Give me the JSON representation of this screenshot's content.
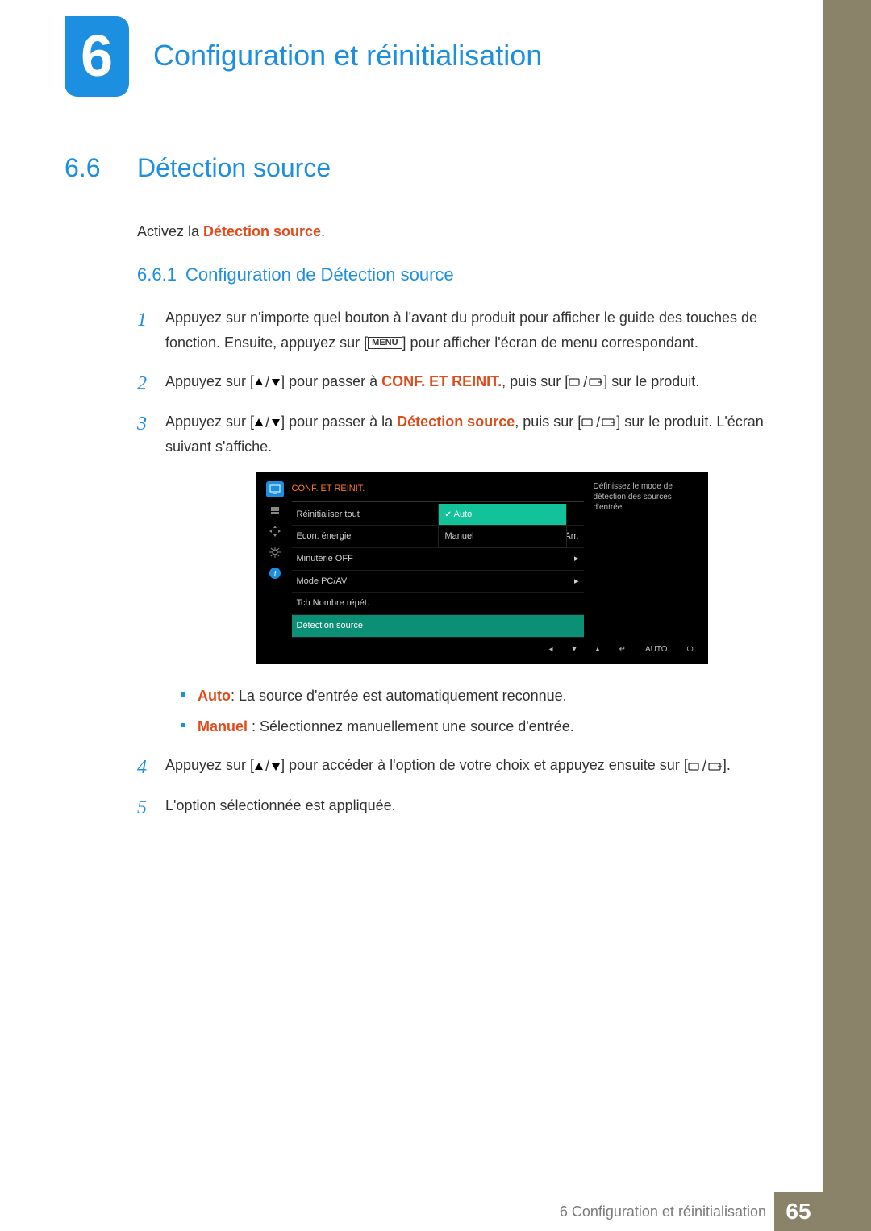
{
  "chapter": {
    "number": "6",
    "title": "Configuration et réinitialisation"
  },
  "section": {
    "number": "6.6",
    "title": "Détection source"
  },
  "intro": {
    "prefix": "Activez la ",
    "term": "Détection source",
    "suffix": "."
  },
  "subsection": {
    "number": "6.6.1",
    "title": "Configuration de Détection source"
  },
  "steps": {
    "s1a": "Appuyez sur n'importe quel bouton à l'avant du produit pour afficher le guide des touches de fonction. Ensuite, appuyez sur [",
    "s1b": "] pour afficher l'écran de menu correspondant.",
    "s2a": "Appuyez sur [",
    "s2b": "] pour passer à ",
    "s2term": "CONF. ET REINIT.",
    "s2c": ", puis sur [",
    "s2d": "] sur le produit.",
    "s3a": "Appuyez sur [",
    "s3b": "] pour passer à la ",
    "s3term": "Détection source",
    "s3c": ", puis sur [",
    "s3d": "] sur le produit. L'écran suivant s'affiche.",
    "s4a": "Appuyez sur [",
    "s4b": "] pour accéder à l'option de votre choix et appuyez ensuite sur [",
    "s4c": "].",
    "s5": "L'option sélectionnée est appliquée."
  },
  "keys": {
    "menu": "MENU"
  },
  "osd": {
    "title": "CONF. ET REINIT.",
    "desc": "Définissez le mode de détection des sources d'entrée.",
    "items": [
      {
        "label": "Réinitialiser tout",
        "value": ""
      },
      {
        "label": "Econ. énergie",
        "value": "Arr."
      },
      {
        "label": "Minuterie OFF",
        "value": "▸"
      },
      {
        "label": "Mode PC/AV",
        "value": "▸"
      },
      {
        "label": "Tch Nombre répét.",
        "value": ""
      },
      {
        "label": "Détection source",
        "value": ""
      }
    ],
    "options": [
      {
        "label": "Auto",
        "highlighted": true
      },
      {
        "label": "Manuel",
        "highlighted": false
      }
    ],
    "footer": {
      "auto": "AUTO"
    }
  },
  "bullets": {
    "b1term": "Auto",
    "b1text": ": La source d'entrée est automatiquement reconnue.",
    "b2term": "Manuel",
    "b2text": " : Sélectionnez manuellement une source d'entrée."
  },
  "footer": {
    "chapter_ref": "6 Configuration et réinitialisation",
    "page": "65"
  }
}
